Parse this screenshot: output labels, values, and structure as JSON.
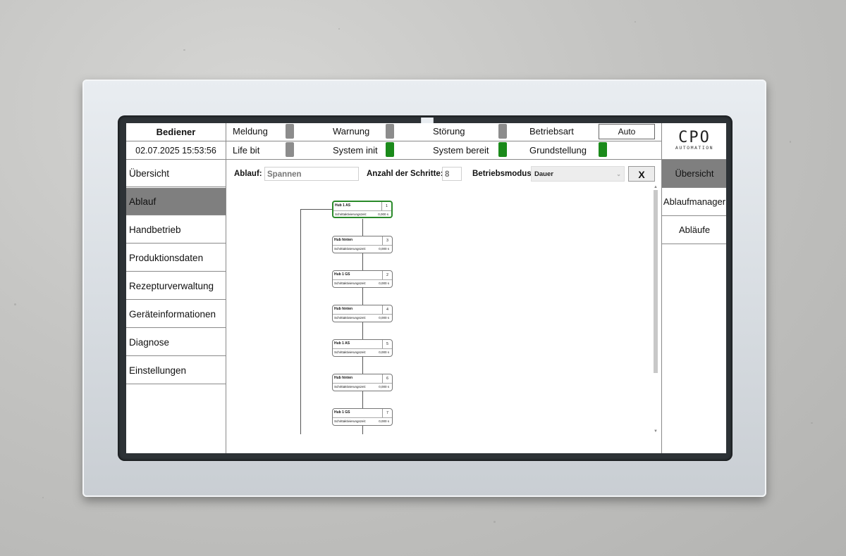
{
  "header": {
    "user_label": "Bediener",
    "datetime": "02.07.2025 15:53:56",
    "status": [
      {
        "label": "Meldung",
        "state": "gray"
      },
      {
        "label": "Warnung",
        "state": "gray"
      },
      {
        "label": "Störung",
        "state": "gray"
      },
      {
        "label": "Life bit",
        "state": "gray"
      },
      {
        "label": "System init",
        "state": "green"
      },
      {
        "label": "System bereit",
        "state": "green"
      },
      {
        "label": "Grundstellung",
        "state": "green"
      }
    ],
    "betriebsart_label": "Betriebsart",
    "betriebsart_value": "Auto",
    "logo_main": "CPO",
    "logo_sub": "AUTOMATION"
  },
  "left_nav": {
    "items": [
      "Übersicht",
      "Ablauf",
      "Handbetrieb",
      "Produktionsdaten",
      "Rezepturverwaltung",
      "Geräteinformationen",
      "Diagnose",
      "Einstellungen"
    ],
    "active_index": 1
  },
  "right_nav": {
    "items": [
      "Übersicht",
      "Ablaufmanager",
      "Abläufe"
    ],
    "active_index": 0
  },
  "toolbar": {
    "ablauf_label": "Ablauf:",
    "ablauf_value": "Spannen",
    "schritte_label": "Anzahl der Schritte:",
    "schritte_value": "8",
    "modus_label": "Betriebsmodus:",
    "modus_value": "Dauer",
    "close_label": "X"
  },
  "flow": {
    "time_label": "Schrittaktivierungszeit:",
    "steps": [
      {
        "name": "Hub 1 AS",
        "number": "1",
        "time": "0,000 s",
        "active": true
      },
      {
        "name": "Hub hinten",
        "number": "3",
        "time": "0,000 s",
        "active": false
      },
      {
        "name": "Hub 1 GS",
        "number": "2",
        "time": "0,000 s",
        "active": false
      },
      {
        "name": "Hub hinten",
        "number": "4",
        "time": "0,000 s",
        "active": false
      },
      {
        "name": "Hub 1 AS",
        "number": "5",
        "time": "0,000 s",
        "active": false
      },
      {
        "name": "Hub hinten",
        "number": "6",
        "time": "0,000 s",
        "active": false
      },
      {
        "name": "Hub 1 GS",
        "number": "7",
        "time": "0,000 s",
        "active": false
      }
    ]
  },
  "colors": {
    "led_gray": "#8c8c8c",
    "led_green": "#1a8a1a",
    "active_nav": "#7f7f7f",
    "active_step_border": "#2a8a2a"
  }
}
